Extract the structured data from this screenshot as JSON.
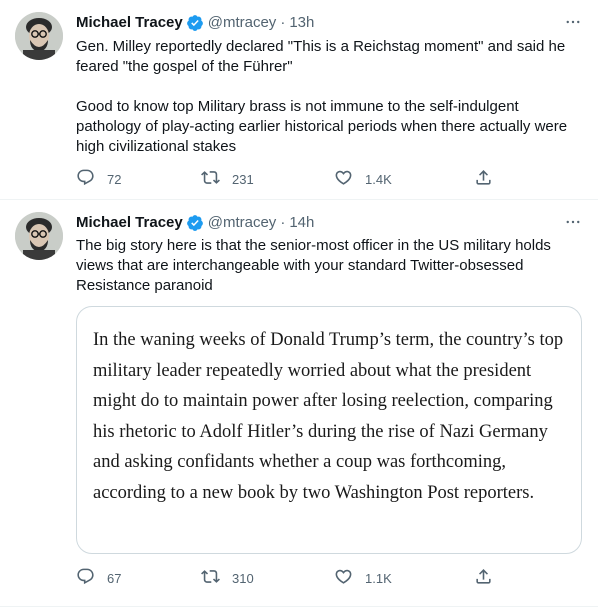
{
  "colors": {
    "verified_blue": "#1d9bf0",
    "secondary_text": "#536471",
    "primary_text": "#0f1419",
    "border": "#cfd9de"
  },
  "icons": {
    "verified": "verified-badge-icon",
    "more": "more-options-icon",
    "reply": "reply-icon",
    "retweet": "retweet-icon",
    "like": "heart-icon",
    "share": "share-icon"
  },
  "tweets": [
    {
      "author": {
        "name": "Michael Tracey",
        "handle": "@mtracey",
        "verified": true
      },
      "separator": "·",
      "time": "13h",
      "text": [
        "Gen. Milley reportedly declared \"This is a Reichstag moment\" and said he feared \"the gospel of the Führer\"",
        "Good to know top Military brass is not immune to the self-indulgent pathology of play-acting earlier historical periods when there actually were high civilizational stakes"
      ],
      "stats": {
        "replies": "72",
        "retweets": "231",
        "likes": "1.4K"
      }
    },
    {
      "author": {
        "name": "Michael Tracey",
        "handle": "@mtracey",
        "verified": true
      },
      "separator": "·",
      "time": "14h",
      "text": [
        "The big story here is that the senior-most officer in the US military holds views that are interchangeable with your standard Twitter-obsessed Resistance paranoid"
      ],
      "media_quote": "In the waning weeks of Donald Trump’s term, the country’s top military leader repeatedly worried about what the president might do to maintain power after losing reelection, comparing his rhetoric to Adolf Hitler’s during the rise of Nazi Germany and asking confidants whether a coup was forthcoming, according to a new book by two Washington Post reporters.",
      "stats": {
        "replies": "67",
        "retweets": "310",
        "likes": "1.1K"
      }
    }
  ]
}
